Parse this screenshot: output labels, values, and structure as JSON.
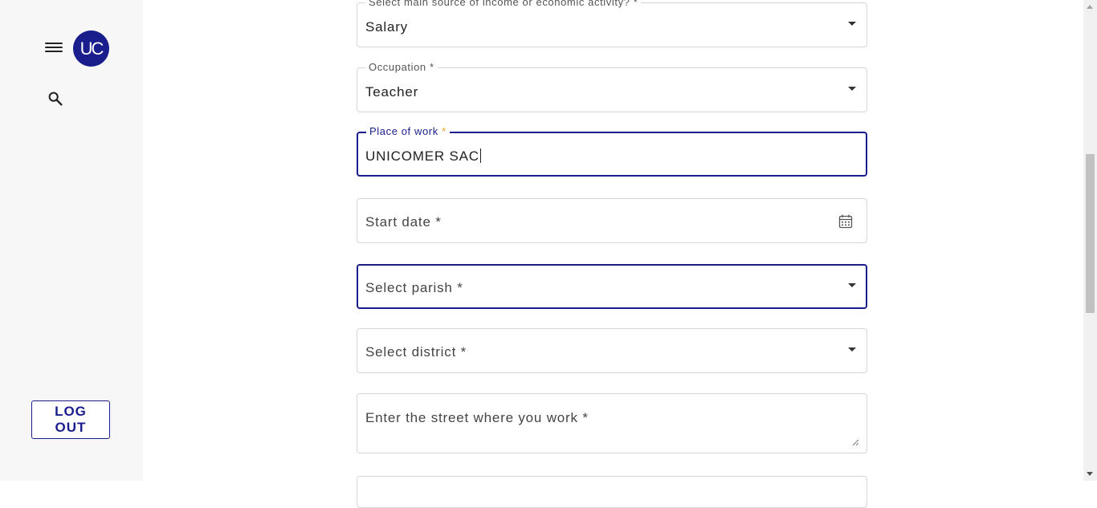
{
  "sidebar": {
    "avatar_text": "UC",
    "logout_label": "LOG OUT",
    "icons": [
      "menu-icon",
      "search-icon"
    ]
  },
  "form": {
    "income_source": {
      "label": "Select main source of income or economic activity? *",
      "value": "Salary"
    },
    "occupation": {
      "label": "Occupation *",
      "value": "Teacher"
    },
    "place_of_work": {
      "label": "Place of work",
      "required_mark": "*",
      "value": "UNICOMER SAC"
    },
    "start_date": {
      "placeholder": "Start date *",
      "icon": "calendar-icon"
    },
    "parish": {
      "placeholder": "Select parish *"
    },
    "district": {
      "placeholder": "Select district *"
    },
    "street": {
      "placeholder": "Enter the street where you work *"
    }
  },
  "colors": {
    "accent": "#1a1e8c",
    "required": "#e8a317",
    "border": "#d6d6d6",
    "sidebar_bg": "#f7f7f7"
  }
}
